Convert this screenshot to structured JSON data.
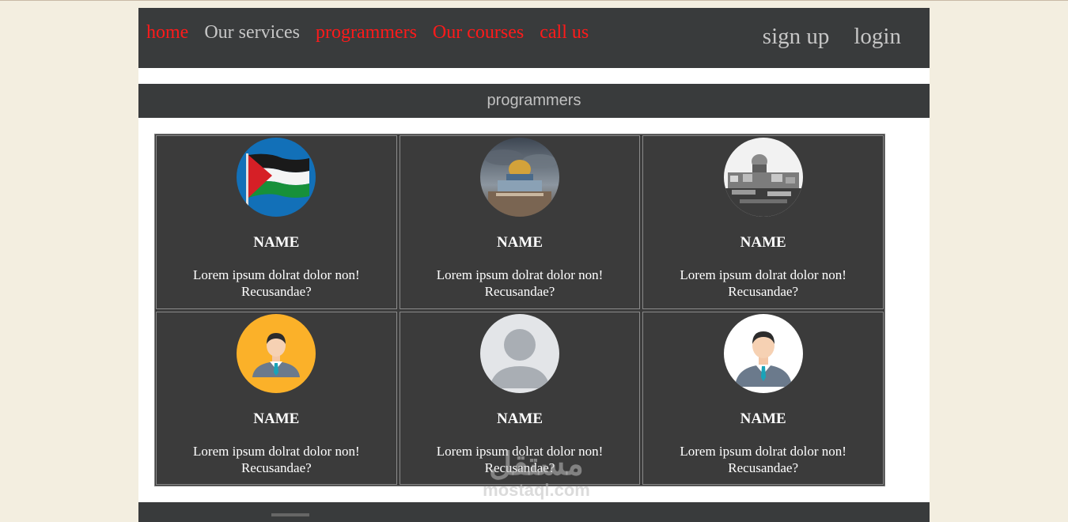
{
  "nav": {
    "links": [
      {
        "label": "home"
      },
      {
        "label": "Our services"
      },
      {
        "label": "programmers"
      },
      {
        "label": "Our courses"
      },
      {
        "label": "call us"
      }
    ],
    "signup_label": "sign up",
    "login_label": "login"
  },
  "section": {
    "title": "programmers"
  },
  "cards": [
    {
      "name": "NAME",
      "description": "Lorem ipsum dolrat dolor non! Recusandae?",
      "avatar": "palestine-flag"
    },
    {
      "name": "NAME",
      "description": "Lorem ipsum dolrat dolor non! Recusandae?",
      "avatar": "dome-of-the-rock"
    },
    {
      "name": "NAME",
      "description": "Lorem ipsum dolrat dolor non! Recusandae?",
      "avatar": "jerusalem-old-city"
    },
    {
      "name": "NAME",
      "description": "Lorem ipsum dolrat dolor non! Recusandae?",
      "avatar": "man-avatar-orange"
    },
    {
      "name": "NAME",
      "description": "Lorem ipsum dolrat dolor non! Recusandae?",
      "avatar": "default-user-avatar"
    },
    {
      "name": "NAME",
      "description": "Lorem ipsum dolrat dolor non! Recusandae?",
      "avatar": "man-avatar-white"
    }
  ],
  "watermark": {
    "arabic": "مستقل",
    "latin": "mostaql.com"
  },
  "colors": {
    "background": "#f3eee0",
    "navbar": "#393b3c",
    "active_link": "#ff1a1a",
    "muted_link": "#c6c6c6",
    "card": "#3b3b3b"
  }
}
